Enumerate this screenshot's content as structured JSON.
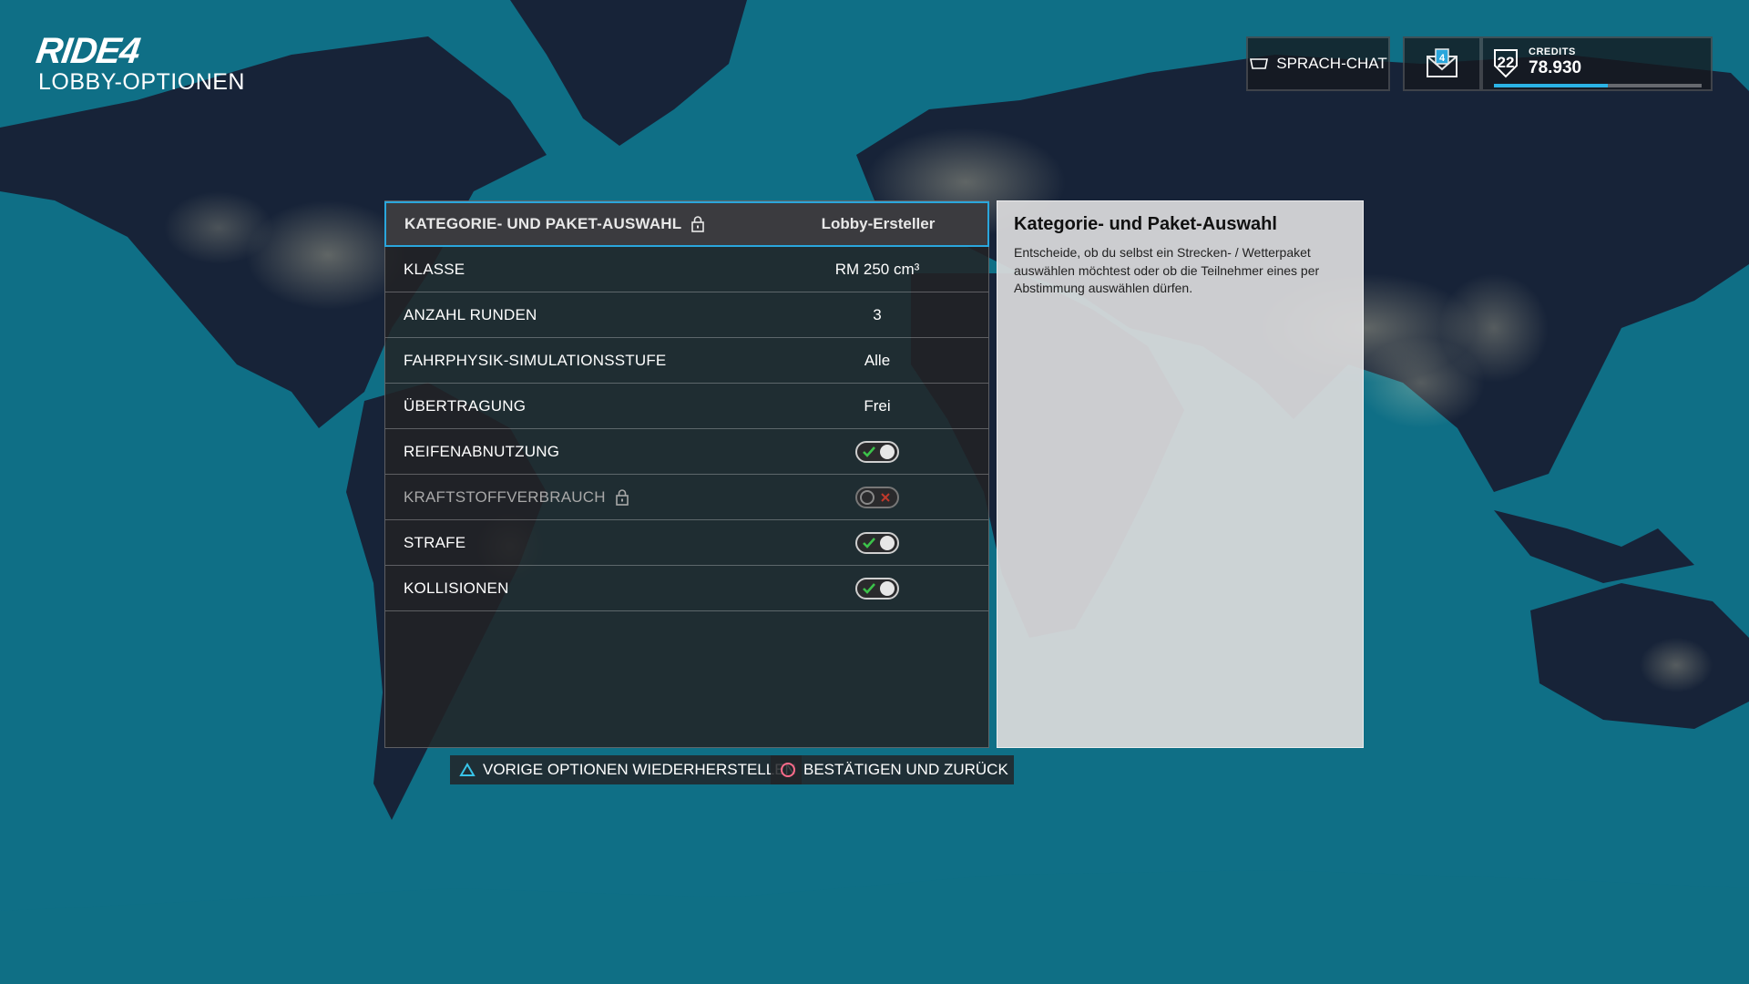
{
  "header": {
    "logo": "RIDE4",
    "page_title": "LOBBY-OPTIONEN"
  },
  "top_right": {
    "voice_chat_label": "SPRACH-CHAT",
    "mail_count": "4",
    "level": "22",
    "credits_label": "CREDITS",
    "credits_value": "78.930",
    "xp_progress_percent": 55
  },
  "options": [
    {
      "label": "KATEGORIE- UND PAKET-AUSWAHL",
      "value": "Lobby-Ersteller",
      "locked": true,
      "selected": true
    },
    {
      "label": "KLASSE",
      "value": "RM 250 cm³"
    },
    {
      "label": "ANZAHL RUNDEN",
      "value": "3"
    },
    {
      "label": "FAHRPHYSIK-SIMULATIONSSTUFE",
      "value": "Alle"
    },
    {
      "label": "ÜBERTRAGUNG",
      "value": "Frei"
    },
    {
      "label": "REIFENABNUTZUNG",
      "toggle": "on"
    },
    {
      "label": "KRAFTSTOFFVERBRAUCH",
      "toggle": "off",
      "locked": true,
      "disabled": true
    },
    {
      "label": "STRAFE",
      "toggle": "on"
    },
    {
      "label": "KOLLISIONEN",
      "toggle": "on"
    }
  ],
  "description": {
    "title": "Kategorie- und Paket-Auswahl",
    "text": "Entscheide, ob du selbst ein Strecken- / Wetterpaket auswählen möchtest oder ob die Teilnehmer eines per Abstimmung auswählen dürfen."
  },
  "actions": {
    "restore_label": "VORIGE OPTIONEN WIEDERHERSTELLEN",
    "confirm_label": "BESTÄTIGEN UND ZURÜCK"
  },
  "colors": {
    "accent": "#2aa6dc",
    "ocean": "#0f6f86",
    "land": "#172338",
    "toggle_on": "#3cc24a",
    "toggle_off": "#c0392b"
  },
  "icons": {
    "voice_chat": "headset-icon",
    "mail": "mail-icon",
    "lock": "lock-icon",
    "restore": "triangle-button-icon",
    "confirm": "circle-button-icon"
  }
}
